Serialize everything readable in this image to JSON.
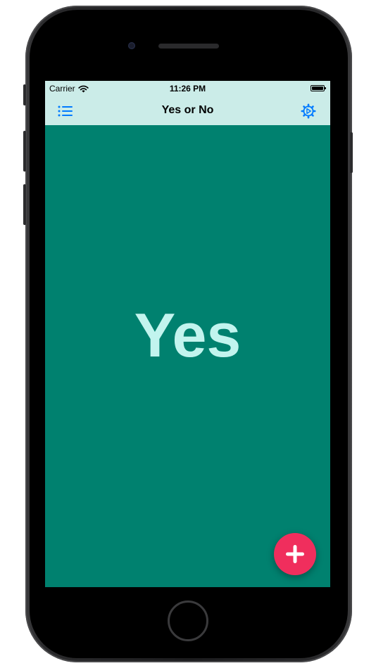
{
  "status_bar": {
    "carrier": "Carrier",
    "time": "11:26 PM"
  },
  "nav_bar": {
    "title": "Yes or No",
    "left_icon": "list-icon",
    "right_icon": "gear-icon"
  },
  "main": {
    "answer": "Yes"
  },
  "fab": {
    "icon": "plus-icon"
  },
  "colors": {
    "bar_background": "#cbece8",
    "screen_background": "#00816f",
    "answer_text": "#c2f4ee",
    "icon_tint": "#007aff",
    "fab_background": "#f02e5d"
  }
}
